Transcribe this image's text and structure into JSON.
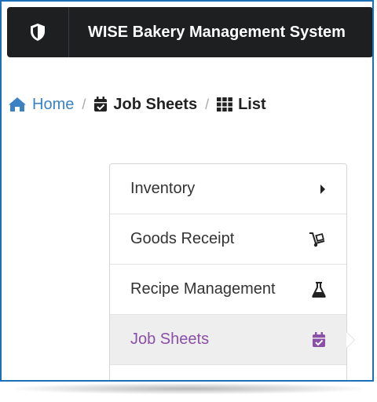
{
  "header": {
    "title": "WISE Bakery Management System",
    "logo_icon": "shield-icon"
  },
  "breadcrumb": {
    "items": [
      {
        "label": "Home",
        "icon": "home-icon"
      },
      {
        "label": "Job Sheets",
        "icon": "calendar-check-icon"
      },
      {
        "label": "List",
        "icon": "grid-icon"
      }
    ],
    "separator": "/"
  },
  "menu": {
    "items": [
      {
        "label": "Inventory",
        "icon": "caret-right-icon"
      },
      {
        "label": "Goods Receipt",
        "icon": "dolly-icon"
      },
      {
        "label": "Recipe Management",
        "icon": "flask-icon"
      },
      {
        "label": "Job Sheets",
        "icon": "calendar-check-icon",
        "active": true
      }
    ]
  },
  "colors": {
    "topbar": "#1e1f21",
    "link": "#3a82c4",
    "active": "#8a4fa6",
    "frame": "#1d6fb8"
  }
}
